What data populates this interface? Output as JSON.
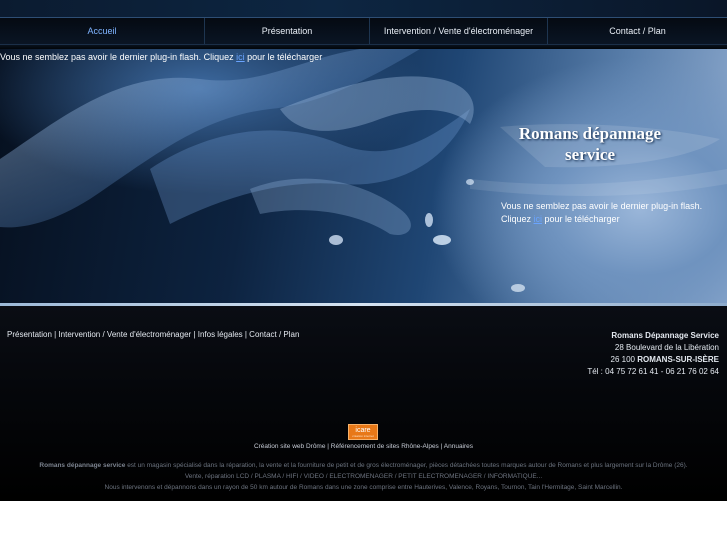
{
  "nav": {
    "items": [
      {
        "label": "Accueil"
      },
      {
        "label": "Présentation"
      },
      {
        "label": "Intervention / Vente d'électroménager"
      },
      {
        "label": "Contact / Plan"
      }
    ]
  },
  "hero": {
    "flash_msg_top_prefix": "Vous ne semblez pas avoir le dernier plug-in flash. Cliquez ",
    "flash_msg_top_link": "ici",
    "flash_msg_top_suffix": " pour le télécharger",
    "brand_line1": "Romans dépannage",
    "brand_line2": "service",
    "flash_msg_right_line1": "Vous ne semblez pas avoir le dernier plug-in flash.",
    "flash_msg_right_prefix": "Cliquez ",
    "flash_msg_right_link": "ici",
    "flash_msg_right_suffix": " pour le télécharger"
  },
  "footer": {
    "links": [
      "Présentation",
      "Intervention / Vente d'électroménager",
      "Infos légales",
      "Contact / Plan"
    ],
    "separator": " | ",
    "address": {
      "company": "Romans Dépannage Service",
      "street": "28 Boulevard de la Libération",
      "postal": "26 100 ",
      "city": "ROMANS-SUR-ISÈRE",
      "phone": "Tél : 04 75 72 61 41 - 06 21 76 02 64"
    },
    "logo": {
      "name": "icare",
      "tagline": "création internet"
    },
    "credits": [
      "Création site web Drôme",
      "Référencement de sites Rhône-Alpes",
      "Annuaires"
    ],
    "desc_bold": "Romans dépannage service",
    "desc_line1": " est un magasin spécialisé dans la réparation, la vente et la fourniture de petit et de gros électroménager, pièces détachées toutes marques autour de Romans et plus largement sur la Drôme (26).",
    "desc_line2": "Vente, réparation LCD / PLASMA / HIFI / VIDEO / ELECTROMENAGER / PETIT ELECTROMENAGER / INFORMATIQUE...",
    "desc_line3": "Nous intervenons et dépannons dans un rayon de 50 km autour de Romans dans une zone comprise entre Hauterives, Valence, Royans, Tournon, Tain l'Hermitage, Saint Marcellin."
  },
  "colors": {
    "active_nav": "#7fb4ff",
    "link": "#6aa4ff",
    "logo": "#e87817"
  }
}
